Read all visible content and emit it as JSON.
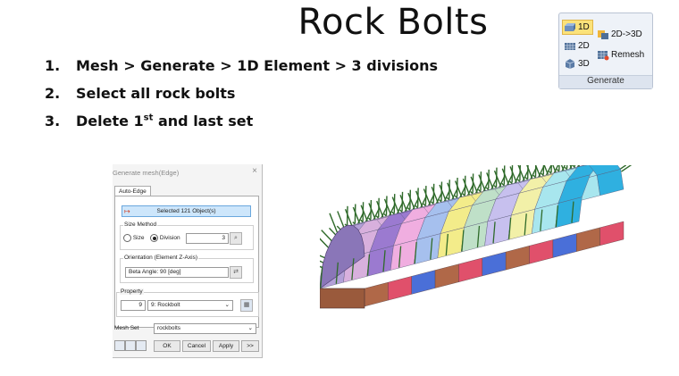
{
  "slide": {
    "title": "Rock Bolts",
    "steps": [
      {
        "num": "1.",
        "text": "Mesh > Generate > 1D Element > 3 divisions"
      },
      {
        "num": "2.",
        "text": "Select all rock bolts"
      },
      {
        "num": "3.",
        "pre": "Delete 1",
        "sup": "st",
        "post": " and last set"
      }
    ]
  },
  "ribbon": {
    "group_label": "Generate",
    "buttons": {
      "b1d": "1D",
      "b2d": "2D",
      "b3d": "3D",
      "b2d3d": "2D->3D",
      "remesh": "Remesh"
    }
  },
  "dialog": {
    "title": "Generate mesh(Edge)",
    "tab": "Auto-Edge",
    "selected": "Selected 121 Object(s)",
    "size_method": {
      "label": "Size Method",
      "opt_size": "Size",
      "opt_division": "Division",
      "value": "3"
    },
    "orientation": {
      "label": "Orientation (Element Z-Axis)",
      "value": "Beta Angle: 90 [deg]"
    },
    "property": {
      "label": "Property",
      "id": "9",
      "value": "9: Rockbolt"
    },
    "mesh_set": {
      "label": "Mesh Set",
      "value": "rockbolts"
    },
    "buttons": {
      "ok": "OK",
      "cancel": "Cancel",
      "apply": "Apply",
      "more": ">>"
    }
  },
  "colors": {
    "ribbon_bg": "#eef2f8",
    "selection": "#cde6fb",
    "highlight": "#fbe27a"
  }
}
